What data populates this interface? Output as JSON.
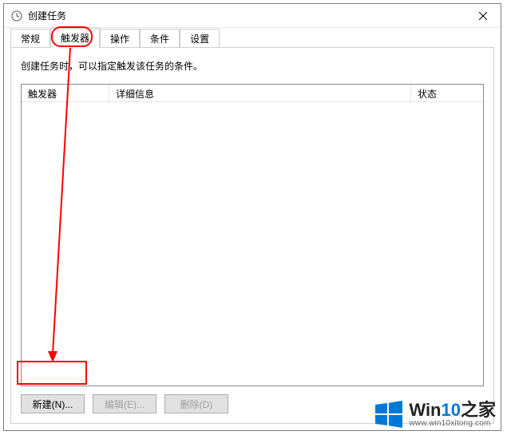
{
  "window": {
    "title": "创建任务"
  },
  "tabs": {
    "t0": "常规",
    "t1": "触发器",
    "t2": "操作",
    "t3": "条件",
    "t4": "设置"
  },
  "panel": {
    "description": "创建任务时，可以指定触发该任务的条件。"
  },
  "listview": {
    "columns": {
      "c1": "触发器",
      "c2": "详细信息",
      "c3": "状态"
    },
    "rows": []
  },
  "buttons": {
    "new": "新建(N)...",
    "edit": "编辑(E)...",
    "delete": "删除(D)"
  },
  "watermark": {
    "brand_prefix": "Win",
    "brand_accent": "10",
    "brand_suffix": "之家",
    "url": "www.win10xitong.com"
  }
}
